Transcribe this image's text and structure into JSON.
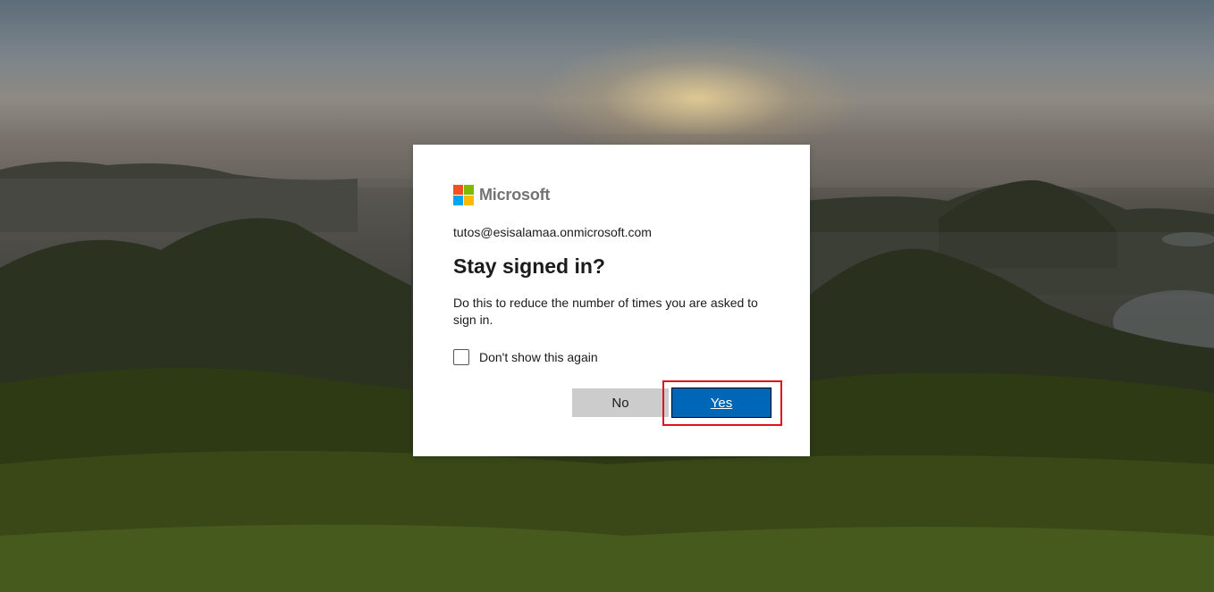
{
  "brand": {
    "name": "Microsoft",
    "logo_colors": [
      "#f25022",
      "#7fba00",
      "#00a4ef",
      "#ffb900"
    ]
  },
  "account": {
    "email": "tutos@esisalamaa.onmicrosoft.com"
  },
  "dialog": {
    "title": "Stay signed in?",
    "description": "Do this to reduce the number of times you are asked to sign in.",
    "checkbox_label": "Don't show this again",
    "checkbox_checked": false,
    "no_label": "No",
    "yes_label": "Yes"
  },
  "colors": {
    "primary_button": "#0067b8",
    "secondary_button": "#cccccc",
    "highlight": "#e0111c"
  }
}
